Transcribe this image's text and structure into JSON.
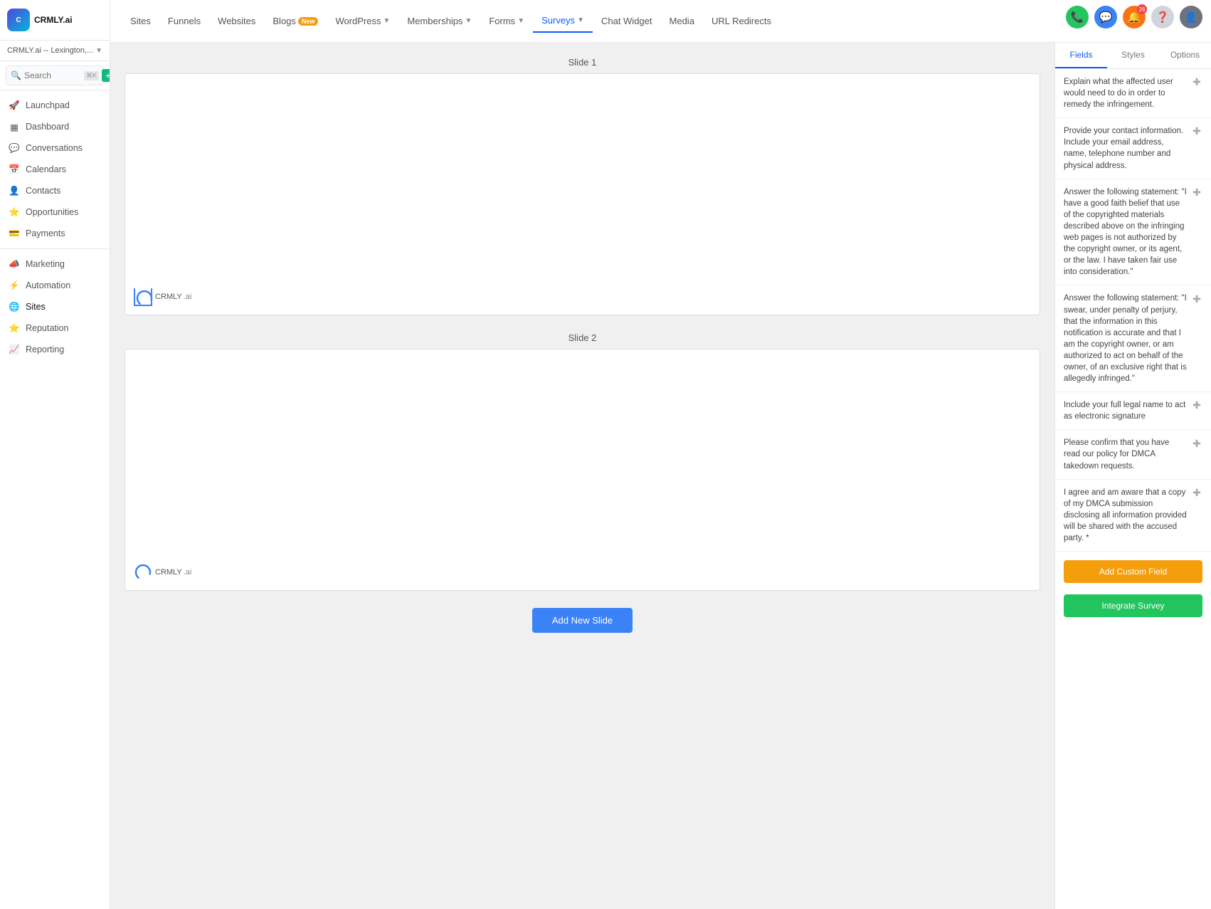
{
  "sidebar": {
    "logo_text": "CRMLY.ai",
    "account_name": "CRMLY.ai -- Lexington,...",
    "search_placeholder": "Search",
    "search_shortcut": "⌘K",
    "nav_items": [
      {
        "id": "launchpad",
        "label": "Launchpad",
        "icon": "🚀"
      },
      {
        "id": "dashboard",
        "label": "Dashboard",
        "icon": "📊"
      },
      {
        "id": "conversations",
        "label": "Conversations",
        "icon": "💬"
      },
      {
        "id": "calendars",
        "label": "Calendars",
        "icon": "📅"
      },
      {
        "id": "contacts",
        "label": "Contacts",
        "icon": "👤"
      },
      {
        "id": "opportunities",
        "label": "Opportunities",
        "icon": "⭐"
      },
      {
        "id": "payments",
        "label": "Payments",
        "icon": "💳"
      },
      {
        "id": "marketing",
        "label": "Marketing",
        "icon": "📣"
      },
      {
        "id": "automation",
        "label": "Automation",
        "icon": "⚡"
      },
      {
        "id": "sites",
        "label": "Sites",
        "icon": "🌐"
      },
      {
        "id": "reputation",
        "label": "Reputation",
        "icon": "⭐"
      },
      {
        "id": "reporting",
        "label": "Reporting",
        "icon": "📈"
      }
    ]
  },
  "topnav": {
    "items": [
      {
        "id": "sites",
        "label": "Sites"
      },
      {
        "id": "funnels",
        "label": "Funnels"
      },
      {
        "id": "websites",
        "label": "Websites"
      },
      {
        "id": "blogs",
        "label": "Blogs",
        "badge": "New"
      },
      {
        "id": "wordpress",
        "label": "WordPress",
        "has_dropdown": true
      },
      {
        "id": "memberships",
        "label": "Memberships",
        "has_dropdown": true
      },
      {
        "id": "forms",
        "label": "Forms",
        "has_dropdown": true
      },
      {
        "id": "surveys",
        "label": "Surveys",
        "has_dropdown": true,
        "active": true
      },
      {
        "id": "chat-widget",
        "label": "Chat Widget"
      },
      {
        "id": "media",
        "label": "Media"
      },
      {
        "id": "url-redirects",
        "label": "URL Redirects"
      }
    ],
    "gear_icon": "⚙"
  },
  "header_icons": [
    {
      "id": "phone",
      "icon": "📞",
      "color": "green"
    },
    {
      "id": "chat",
      "icon": "💬",
      "color": "blue"
    },
    {
      "id": "notifications",
      "icon": "🔔",
      "color": "orange",
      "badge": "26"
    },
    {
      "id": "help",
      "icon": "❓",
      "color": "gray"
    },
    {
      "id": "avatar",
      "icon": "👤",
      "color": "avatar"
    }
  ],
  "slides": [
    {
      "id": "slide1",
      "label": "Slide 1"
    },
    {
      "id": "slide2",
      "label": "Slide 2"
    }
  ],
  "add_slide_button": "Add New Slide",
  "logo_text1": "CRMLY",
  "logo_text2": ".ai",
  "right_panel": {
    "tabs": [
      {
        "id": "fields",
        "label": "Fields",
        "active": true
      },
      {
        "id": "styles",
        "label": "Styles"
      },
      {
        "id": "options",
        "label": "Options"
      }
    ],
    "fields": [
      {
        "id": "f1",
        "text": "Explain what the affected user would need to do in order to remedy the infringement."
      },
      {
        "id": "f2",
        "text": "Provide your contact information. Include your email address, name, telephone number and physical address."
      },
      {
        "id": "f3",
        "text": "Answer the following statement: \"I have a good faith belief that use of the copyrighted materials described above on the infringing web pages is not authorized by the copyright owner, or its agent, or the law. I have taken fair use into consideration.\""
      },
      {
        "id": "f4",
        "text": "Answer the following statement: \"I swear, under penalty of perjury, that the information in this notification is accurate and that I am the copyright owner, or am authorized to act on behalf of the owner, of an exclusive right that is allegedly infringed.\""
      },
      {
        "id": "f5",
        "text": "Include your full legal name to act as electronic signature"
      },
      {
        "id": "f6",
        "text": "Please confirm that you have read our policy for DMCA takedown requests."
      },
      {
        "id": "f7",
        "text": "I agree and am aware that a copy of my DMCA submission disclosing all information provided will be shared with the accused party. *"
      }
    ],
    "add_custom_label": "Add Custom Field",
    "integrate_label": "Integrate Survey"
  }
}
